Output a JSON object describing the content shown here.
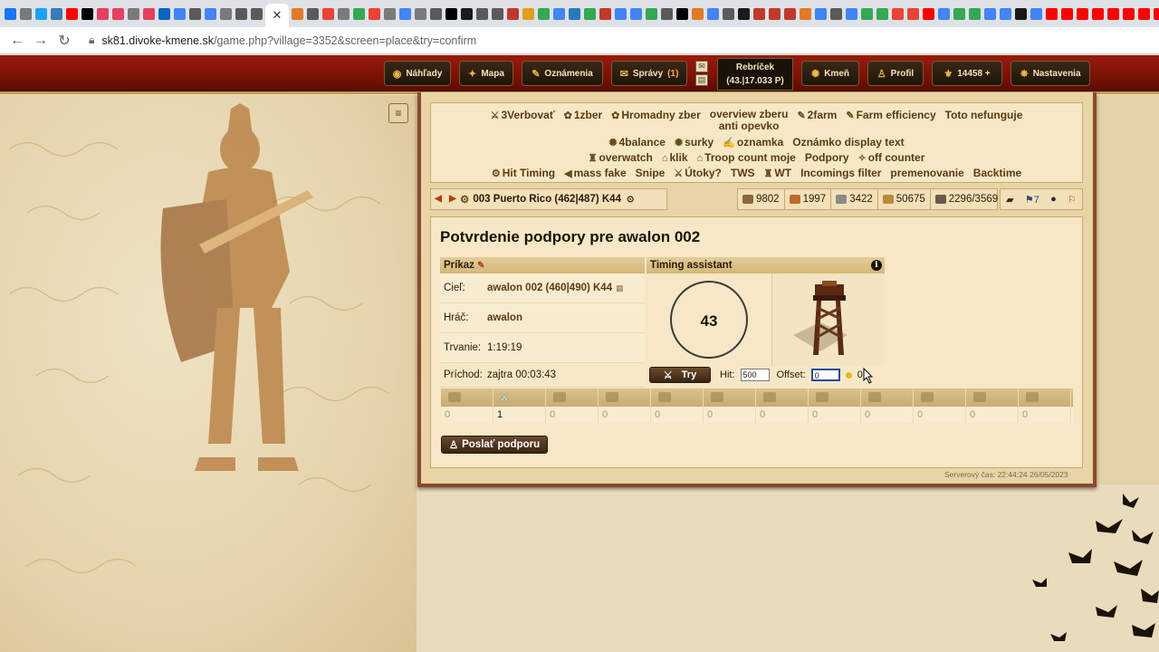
{
  "browser": {
    "tab_favicon_colors": [
      "#1877f2",
      "#7a7a7a",
      "#1da1f2",
      "#3a7ab8",
      "#ff0000",
      "#000000",
      "#e4405f",
      "#e4405f",
      "#7a7a7a",
      "#e4405f",
      "#0a66c2",
      "#4285f4",
      "#5a5a5a",
      "#4285f4",
      "#7a7a7a",
      "#5a5a5a",
      "#5a5a5a"
    ],
    "active_tab_close": "✕",
    "tab_favicon_colors_2": [
      "#e07a2a",
      "#5a5a5a",
      "#ea4335",
      "#7a7a7a",
      "#34a853",
      "#ea4335",
      "#7a7a7a",
      "#4285f4",
      "#7a7a7a",
      "#5a5a5a",
      "#000000",
      "#1a1a1a",
      "#5a5a5a",
      "#5a5a5a",
      "#c0392b",
      "#e0a020",
      "#34a853",
      "#4285f4",
      "#2a7aba",
      "#34a853",
      "#c0392b",
      "#4285f4",
      "#4285f4",
      "#34a853",
      "#5a5a5a",
      "#000000",
      "#e07a2a",
      "#4285f4",
      "#5a5a5a",
      "#1a1a1a",
      "#c0392b",
      "#c0392b",
      "#c0392b",
      "#e07a2a",
      "#4285f4",
      "#5a5a5a",
      "#4285f4",
      "#34a853",
      "#34a853",
      "#ea4335",
      "#ea4335",
      "#ff0000",
      "#4285f4",
      "#34a853",
      "#34a853",
      "#4285f4",
      "#4285f4",
      "#1a1a1a",
      "#4285f4",
      "#ff0000",
      "#ff0000",
      "#ff0000",
      "#ff0000",
      "#ff0000",
      "#ff0000",
      "#ff0000",
      "#ff0000",
      "#34a853",
      "#34a853"
    ],
    "url_host": "sk81.divoke-kmene.sk",
    "url_path": "/game.php?village=3352&screen=place&try=confirm"
  },
  "header": {
    "buttons": [
      {
        "label": "Náhľady",
        "icon": "eye-icon"
      },
      {
        "label": "Mapa",
        "icon": "compass-icon"
      },
      {
        "label": "Oznámenia",
        "icon": "scroll-icon"
      },
      {
        "label": "Správy",
        "badge": "(1)",
        "icon": "envelope-icon"
      },
      {
        "label": "Kmeň",
        "icon": "tribe-icon"
      },
      {
        "label": "Profil",
        "icon": "profile-icon"
      },
      {
        "label": "14458 +",
        "icon": "premium-icon"
      },
      {
        "label": "Nastavenia",
        "icon": "settings-icon"
      }
    ],
    "rank_title": "Rebríček",
    "rank_value": "(43.|17.033 P)"
  },
  "quickbar": {
    "row1": [
      "3Verbovať",
      "1zber",
      "Hromadny zber",
      "overview zberu",
      "2farm",
      "Farm efficiency",
      "Toto nefunguje"
    ],
    "row1_sub": "anti opevko",
    "row2": [
      "4balance",
      "surky",
      "oznamka",
      "Oznámko display text"
    ],
    "row3": [
      "overwatch",
      "klik",
      "Troop count moje",
      "Podpory",
      "off counter"
    ],
    "row4": [
      "Hit Timing",
      "mass fake",
      "Snipe",
      "Útoky?",
      "TWS",
      "WT",
      "Incomings filter",
      "premenovanie",
      "Backtime"
    ]
  },
  "village": {
    "name": "003 Puerto Rico (462|487) K44",
    "resources": [
      {
        "value": "9802",
        "color": "#8a6a3a"
      },
      {
        "value": "1997",
        "color": "#c0692a"
      },
      {
        "value": "3422",
        "color": "#8a8a8a"
      },
      {
        "value": "50675",
        "color": "#b88a3a"
      },
      {
        "value": "2296/3569",
        "color": "#6a5a4a"
      }
    ],
    "extra_count": "7"
  },
  "page": {
    "title": "Potvrdenie podpory pre awalon 002",
    "command_header": "Príkaz",
    "timing_header": "Timing assistant",
    "target_label": "Cieľ:",
    "target_value": "awalon 002 (460|490) K44",
    "player_label": "Hráč:",
    "player_value": "awalon",
    "duration_label": "Trvanie:",
    "duration_value": "1:19:19",
    "arrival_label": "Príchod:",
    "arrival_value": "zajtra 00:03:43",
    "countdown": "43",
    "try_label": "Try",
    "hit_label": "Hit:",
    "hit_value": "500",
    "offset_label": "Offset:",
    "offset_value": "0",
    "offset_extra": "0",
    "unit_counts": [
      "0",
      "1",
      "0",
      "0",
      "0",
      "0",
      "0",
      "0",
      "0",
      "0",
      "0",
      "0"
    ],
    "send_label": "Poslať podporu",
    "server_time": "Serverový čas: 22:44:24 26/05/2023"
  }
}
